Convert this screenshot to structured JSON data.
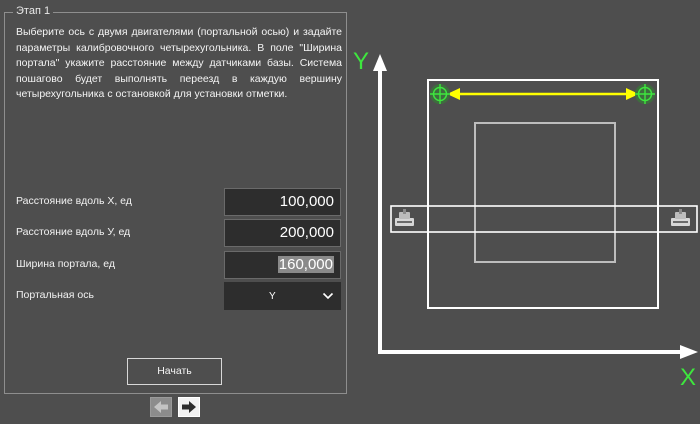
{
  "panel": {
    "legend": "Этап 1",
    "intro": "Выберите ось с двумя двигателями (портальной осью) и задайте параметры калибровочного четырехугольника. В поле \"Ширина портала\" укажите расстояние между датчиками базы. Система пошагово будет выполнять переезд в каждую вершину четырехугольника с остановкой для установки отметки."
  },
  "fields": {
    "distance_x": {
      "label": "Расстояние вдоль X, ед",
      "value": "100,000"
    },
    "distance_y": {
      "label": "Расстояние вдоль У, ед",
      "value": "200,000"
    },
    "portal_width": {
      "label": "Ширина портала, ед",
      "value": "160,000"
    },
    "portal_axis": {
      "label": "Портальная ось",
      "value": "Y"
    }
  },
  "buttons": {
    "start": "Начать",
    "prev_icon": "arrow-left-icon",
    "next_icon": "arrow-right-icon"
  },
  "diagram": {
    "axis_y_label": "Y",
    "axis_x_label": "X",
    "axis_label_color": "#3ee63e",
    "dimension_arrow_color": "#ffff00",
    "target_color": "#3ee63e",
    "icons": [
      "crosshair-target-icon",
      "crosshair-target-icon",
      "sensor-icon",
      "sensor-icon"
    ]
  }
}
